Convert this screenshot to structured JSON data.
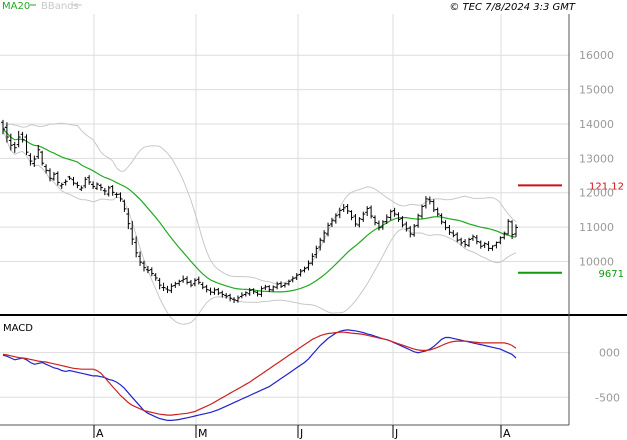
{
  "header": {
    "legend": [
      {
        "name": "MA20",
        "color": "#22aa22"
      },
      {
        "name": "BBands",
        "color": "#c8c8c8"
      }
    ],
    "credit": "© TEC 7/8/2024 3:3 GMT"
  },
  "chart_data": [
    {
      "type": "ohlc",
      "panel": "price",
      "y_ticks": [
        "16000",
        "15000",
        "14000",
        "13000",
        "12000",
        "11000",
        "10000"
      ],
      "ylim": [
        8500,
        17200
      ],
      "x_ticks": [
        "A",
        "M",
        "J",
        "J",
        "A"
      ],
      "grid": true,
      "n_sessions": 132,
      "levels": [
        {
          "label": "121.12",
          "value": 12212,
          "color": "#cc1111"
        },
        {
          "label": "9671",
          "value": 9671,
          "color": "#119911"
        }
      ],
      "close": [
        13850,
        13620,
        13380,
        13310,
        13620,
        13540,
        13180,
        12920,
        12980,
        13250,
        12860,
        12650,
        12420,
        12540,
        12300,
        12240,
        12330,
        12420,
        12280,
        12210,
        12140,
        12390,
        12310,
        12180,
        12250,
        12150,
        12050,
        12140,
        12010,
        11950,
        11820,
        11530,
        11100,
        10650,
        10250,
        9980,
        9820,
        9740,
        9650,
        9520,
        9310,
        9240,
        9170,
        9280,
        9350,
        9420,
        9480,
        9390,
        9310,
        9450,
        9390,
        9250,
        9180,
        9110,
        9170,
        9080,
        9040,
        8990,
        8930,
        8880,
        8940,
        9020,
        9090,
        9160,
        9120,
        9050,
        9210,
        9260,
        9180,
        9260,
        9340,
        9280,
        9350,
        9420,
        9510,
        9600,
        9720,
        9800,
        9950,
        10150,
        10380,
        10620,
        10830,
        11050,
        11200,
        11330,
        11480,
        11560,
        11470,
        11280,
        11090,
        11240,
        11380,
        11540,
        11320,
        11130,
        10980,
        11150,
        11290,
        11450,
        11380,
        11220,
        11060,
        10950,
        10800,
        11030,
        11330,
        11600,
        11820,
        11750,
        11500,
        11380,
        11150,
        10980,
        10850,
        10760,
        10620,
        10540,
        10490,
        10640,
        10720,
        10580,
        10440,
        10520,
        10380,
        10450,
        10550,
        10690,
        10820,
        11170,
        10780,
        10990
      ],
      "open": [
        14050,
        13900,
        13520,
        13400,
        13400,
        13700,
        13620,
        13080,
        12850,
        13050,
        13180,
        12760,
        12640,
        12400,
        12560,
        12200,
        12300,
        12460,
        12380,
        12260,
        12100,
        12200,
        12440,
        12240,
        12130,
        12210,
        12060,
        11960,
        12180,
        11950,
        11960,
        11750,
        11380,
        10950,
        10550,
        10150,
        9950,
        9760,
        9760,
        9600,
        9450,
        9240,
        9200,
        9150,
        9300,
        9360,
        9440,
        9500,
        9400,
        9350,
        9480,
        9330,
        9260,
        9160,
        9100,
        9180,
        9090,
        9010,
        9010,
        8900,
        8860,
        8980,
        9040,
        9060,
        9180,
        9100,
        9040,
        9230,
        9270,
        9170,
        9250,
        9360,
        9300,
        9350,
        9460,
        9520,
        9620,
        9740,
        9820,
        9950,
        10200,
        10420,
        10600,
        10800,
        11090,
        11180,
        11360,
        11510,
        11600,
        11450,
        11320,
        11060,
        11220,
        11430,
        11560,
        11280,
        11110,
        11000,
        11160,
        11280,
        11480,
        11360,
        11250,
        11090,
        10970,
        10780,
        11050,
        11320,
        11620,
        11810,
        11740,
        11510,
        11340,
        11130,
        10990,
        10830,
        10790,
        10630,
        10580,
        10470,
        10660,
        10690,
        10560,
        10470,
        10500,
        10380,
        10470,
        10560,
        10700,
        10800,
        11150,
        10800
      ],
      "high": [
        14120,
        14050,
        13720,
        13480,
        13800,
        13770,
        13700,
        13150,
        13080,
        13390,
        13220,
        12830,
        12710,
        12600,
        12620,
        12290,
        12390,
        12490,
        12460,
        12320,
        12210,
        12460,
        12510,
        12330,
        12300,
        12260,
        12140,
        12200,
        12220,
        12010,
        12010,
        11800,
        11550,
        11180,
        10730,
        10290,
        10020,
        9870,
        9830,
        9660,
        9520,
        9380,
        9290,
        9360,
        9410,
        9470,
        9590,
        9570,
        9460,
        9510,
        9560,
        9400,
        9320,
        9240,
        9240,
        9230,
        9150,
        9080,
        9060,
        8960,
        9010,
        9100,
        9130,
        9230,
        9220,
        9150,
        9280,
        9320,
        9310,
        9300,
        9410,
        9420,
        9380,
        9470,
        9570,
        9660,
        9780,
        9850,
        10030,
        10240,
        10460,
        10690,
        10910,
        11130,
        11270,
        11400,
        11560,
        11670,
        11670,
        11490,
        11380,
        11290,
        11450,
        11610,
        11630,
        11340,
        11190,
        11200,
        11370,
        11510,
        11560,
        11430,
        11320,
        11160,
        11030,
        11090,
        11390,
        11650,
        11900,
        11890,
        11810,
        11570,
        11400,
        11200,
        11060,
        10910,
        10850,
        10690,
        10650,
        10690,
        10780,
        10770,
        10610,
        10560,
        10590,
        10470,
        10580,
        10730,
        10870,
        11230,
        11200,
        11080
      ],
      "low": [
        13700,
        13460,
        13230,
        13160,
        13320,
        13460,
        13100,
        12790,
        12750,
        12980,
        12790,
        12560,
        12330,
        12350,
        12210,
        12110,
        12210,
        12370,
        12210,
        12130,
        12050,
        12130,
        12230,
        12110,
        12080,
        12060,
        11930,
        11890,
        11910,
        11850,
        11740,
        11440,
        10940,
        10480,
        10120,
        9870,
        9710,
        9660,
        9570,
        9440,
        9190,
        9140,
        9080,
        9080,
        9230,
        9290,
        9380,
        9330,
        9250,
        9280,
        9330,
        9190,
        9100,
        9020,
        9030,
        9020,
        8950,
        8920,
        8840,
        8790,
        8800,
        8930,
        8980,
        9000,
        9050,
        8980,
        8970,
        9170,
        9110,
        9120,
        9190,
        9230,
        9240,
        9300,
        9390,
        9460,
        9560,
        9680,
        9740,
        9880,
        10090,
        10320,
        10540,
        10730,
        11000,
        11100,
        11260,
        11440,
        11380,
        11200,
        11010,
        10990,
        11150,
        11320,
        11250,
        11050,
        10900,
        10920,
        11090,
        11200,
        11300,
        11150,
        10990,
        10870,
        10700,
        10720,
        10980,
        11250,
        11540,
        11660,
        11440,
        11310,
        11080,
        10910,
        10770,
        10700,
        10560,
        10460,
        10410,
        10420,
        10600,
        10500,
        10370,
        10390,
        10300,
        10310,
        10380,
        10500,
        10640,
        10780,
        10650,
        10720
      ]
    },
    {
      "type": "line",
      "panel": "macd",
      "title": "MACD",
      "y_ticks": [
        "000",
        "-500"
      ],
      "ylim": [
        -800,
        400
      ],
      "series": [
        {
          "name": "",
          "color": "#2222cc",
          "values": [
            -30,
            -40,
            -60,
            -80,
            -70,
            -60,
            -80,
            -110,
            -130,
            -120,
            -110,
            -130,
            -150,
            -170,
            -180,
            -200,
            -210,
            -200,
            -210,
            -220,
            -230,
            -240,
            -250,
            -260,
            -260,
            -270,
            -280,
            -300,
            -310,
            -330,
            -360,
            -400,
            -450,
            -500,
            -550,
            -600,
            -650,
            -680,
            -700,
            -720,
            -740,
            -750,
            -760,
            -760,
            -755,
            -750,
            -740,
            -730,
            -720,
            -710,
            -700,
            -690,
            -680,
            -670,
            -655,
            -640,
            -620,
            -600,
            -580,
            -560,
            -540,
            -520,
            -500,
            -480,
            -460,
            -440,
            -420,
            -400,
            -380,
            -350,
            -320,
            -290,
            -260,
            -230,
            -200,
            -170,
            -140,
            -110,
            -70,
            -20,
            30,
            80,
            120,
            160,
            190,
            220,
            240,
            250,
            255,
            250,
            245,
            235,
            225,
            210,
            200,
            185,
            170,
            155,
            145,
            130,
            110,
            90,
            70,
            50,
            30,
            10,
            0,
            10,
            20,
            40,
            70,
            110,
            150,
            170,
            170,
            160,
            150,
            140,
            130,
            120,
            110,
            100,
            90,
            80,
            70,
            60,
            50,
            40,
            20,
            0,
            -20,
            -60
          ]
        },
        {
          "name": "",
          "color": "#cc2222",
          "values": [
            -20,
            -25,
            -35,
            -45,
            -55,
            -60,
            -65,
            -75,
            -85,
            -95,
            -100,
            -105,
            -115,
            -125,
            -135,
            -145,
            -155,
            -165,
            -175,
            -180,
            -185,
            -185,
            -185,
            -185,
            -200,
            -230,
            -280,
            -330,
            -380,
            -430,
            -480,
            -520,
            -560,
            -590,
            -610,
            -630,
            -650,
            -660,
            -670,
            -680,
            -690,
            -695,
            -700,
            -700,
            -695,
            -690,
            -685,
            -680,
            -670,
            -660,
            -640,
            -620,
            -600,
            -580,
            -555,
            -530,
            -505,
            -480,
            -455,
            -430,
            -405,
            -380,
            -355,
            -330,
            -300,
            -270,
            -240,
            -210,
            -180,
            -150,
            -120,
            -90,
            -60,
            -30,
            0,
            30,
            60,
            90,
            120,
            150,
            170,
            190,
            205,
            215,
            220,
            225,
            230,
            230,
            225,
            220,
            215,
            210,
            205,
            195,
            185,
            175,
            165,
            155,
            145,
            130,
            115,
            100,
            85,
            70,
            55,
            40,
            30,
            25,
            25,
            30,
            45,
            60,
            80,
            100,
            115,
            125,
            130,
            130,
            130,
            125,
            120,
            115,
            110,
            110,
            110,
            110,
            110,
            110,
            110,
            100,
            80,
            50
          ]
        }
      ]
    }
  ]
}
